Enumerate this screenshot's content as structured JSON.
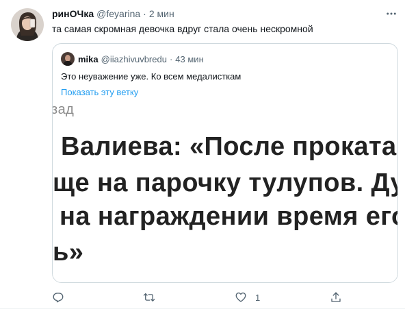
{
  "tweet": {
    "author_name": "ринОЧка",
    "author_handle": "@feyarina",
    "separator": "·",
    "time": "2 мин",
    "text": "та самая скромная девочка вдруг стала очень нескромной",
    "avatar_icon": "user-photo-avatar",
    "more_icon": "more-dots-icon"
  },
  "quoted_tweet": {
    "author_name": "mika",
    "author_handle": "@iiazhivuvbredu",
    "separator": "·",
    "time": "43 мин",
    "text": "Это неуважение уже. Ко всем медалисткам",
    "show_thread_label": "Показать эту ветку",
    "media_lines": [
      "зад",
      "Валиева: «После проката р",
      "ще на парочку тулупов. Дум",
      "на награждении время его",
      "ь»"
    ]
  },
  "actions": {
    "reply_icon": "reply-icon",
    "retweet_icon": "retweet-icon",
    "like_icon": "heart-icon",
    "like_count": "1",
    "share_icon": "share-icon"
  },
  "colors": {
    "link": "#1d9bf0",
    "secondary_text": "#536471",
    "border": "#cfd9de"
  }
}
